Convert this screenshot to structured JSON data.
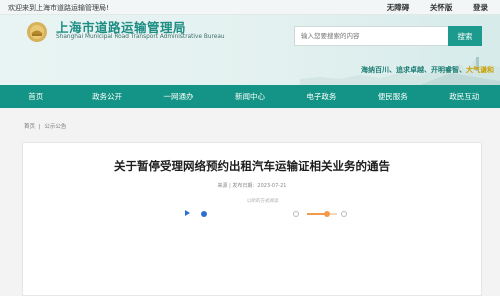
{
  "topbar": {
    "welcome": "欢迎来到上海市道路运输管理局!",
    "links": [
      "无障碍",
      "关怀版",
      "登录"
    ]
  },
  "header": {
    "title": "上海市道路运输管理局",
    "subtitle": "Shanghai Municipal Road Transport Administrative Bureau",
    "search_placeholder": "输入您要搜索的内容",
    "search_button": "搜索",
    "slogan_main": "海纳百川、追求卓越、开明睿智、",
    "slogan_highlight": "大气谦和",
    "logo_icon": "seal-emblem-icon"
  },
  "nav": {
    "items": [
      "首页",
      "政务公开",
      "一网通办",
      "新闻中心",
      "电子政务",
      "便民服务",
      "政民互动"
    ]
  },
  "breadcrumb": {
    "items": [
      "首页",
      "公示公告"
    ],
    "separator": "|"
  },
  "article": {
    "title": "关于暂停受理网络预约出租汽车运输证相关业务的通告",
    "meta": "来源 | 发布日期：2023-07-21",
    "audio_label": "以听的方式阅读",
    "audio_volume": 0.67
  },
  "colors": {
    "accent": "#149486",
    "title_green": "#1e8d84",
    "play_blue": "#2a6fd6",
    "volume_orange": "#f39a4c"
  }
}
